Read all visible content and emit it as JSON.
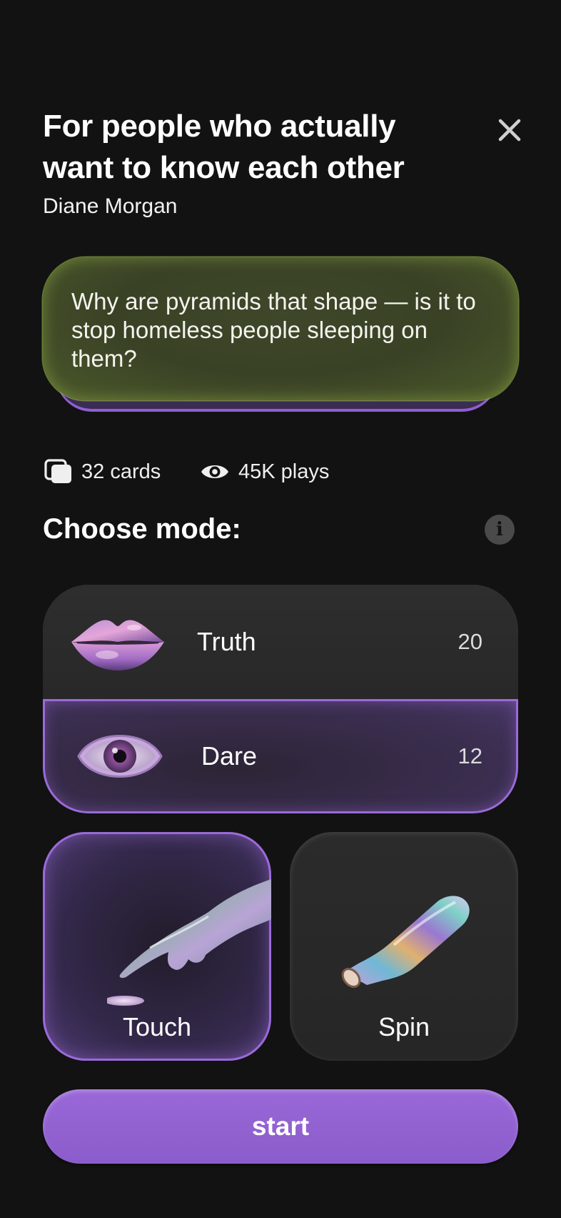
{
  "header": {
    "title": "For people who actually want to know each other",
    "author": "Diane Morgan",
    "close_icon": "close-icon"
  },
  "question_card": {
    "text": "Why are pyramids that shape — is it to stop homeless people sleeping on them?"
  },
  "stats": {
    "cards_icon": "cards-stack-icon",
    "cards_label": "32 cards",
    "plays_icon": "eye-icon",
    "plays_label": "45K plays"
  },
  "modes": {
    "heading": "Choose mode:",
    "info_icon": "info-icon",
    "info_glyph": "i",
    "list": [
      {
        "label": "Truth",
        "count": "20",
        "icon": "lips-icon",
        "selected": false
      },
      {
        "label": "Dare",
        "count": "12",
        "icon": "eye-icon",
        "selected": true
      }
    ],
    "play_styles": [
      {
        "label": "Touch",
        "icon": "pointing-hand-icon",
        "selected": true
      },
      {
        "label": "Spin",
        "icon": "bottle-icon",
        "selected": false
      }
    ]
  },
  "start_button": {
    "label": "start"
  },
  "colors": {
    "background": "#121212",
    "accent_purple": "#8b5ccb",
    "card_green": "#3f472a",
    "tile_dark": "#2a2a2a"
  }
}
